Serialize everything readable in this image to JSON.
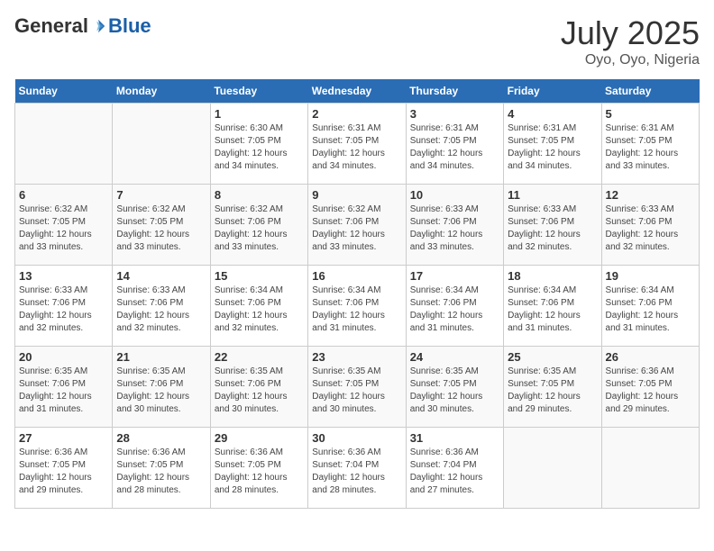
{
  "header": {
    "logo_general": "General",
    "logo_blue": "Blue",
    "month_title": "July 2025",
    "location": "Oyo, Oyo, Nigeria"
  },
  "weekdays": [
    "Sunday",
    "Monday",
    "Tuesday",
    "Wednesday",
    "Thursday",
    "Friday",
    "Saturday"
  ],
  "weeks": [
    [
      {
        "day": "",
        "sunrise": "",
        "sunset": "",
        "daylight": ""
      },
      {
        "day": "",
        "sunrise": "",
        "sunset": "",
        "daylight": ""
      },
      {
        "day": "1",
        "sunrise": "Sunrise: 6:30 AM",
        "sunset": "Sunset: 7:05 PM",
        "daylight": "Daylight: 12 hours and 34 minutes."
      },
      {
        "day": "2",
        "sunrise": "Sunrise: 6:31 AM",
        "sunset": "Sunset: 7:05 PM",
        "daylight": "Daylight: 12 hours and 34 minutes."
      },
      {
        "day": "3",
        "sunrise": "Sunrise: 6:31 AM",
        "sunset": "Sunset: 7:05 PM",
        "daylight": "Daylight: 12 hours and 34 minutes."
      },
      {
        "day": "4",
        "sunrise": "Sunrise: 6:31 AM",
        "sunset": "Sunset: 7:05 PM",
        "daylight": "Daylight: 12 hours and 34 minutes."
      },
      {
        "day": "5",
        "sunrise": "Sunrise: 6:31 AM",
        "sunset": "Sunset: 7:05 PM",
        "daylight": "Daylight: 12 hours and 33 minutes."
      }
    ],
    [
      {
        "day": "6",
        "sunrise": "Sunrise: 6:32 AM",
        "sunset": "Sunset: 7:05 PM",
        "daylight": "Daylight: 12 hours and 33 minutes."
      },
      {
        "day": "7",
        "sunrise": "Sunrise: 6:32 AM",
        "sunset": "Sunset: 7:05 PM",
        "daylight": "Daylight: 12 hours and 33 minutes."
      },
      {
        "day": "8",
        "sunrise": "Sunrise: 6:32 AM",
        "sunset": "Sunset: 7:06 PM",
        "daylight": "Daylight: 12 hours and 33 minutes."
      },
      {
        "day": "9",
        "sunrise": "Sunrise: 6:32 AM",
        "sunset": "Sunset: 7:06 PM",
        "daylight": "Daylight: 12 hours and 33 minutes."
      },
      {
        "day": "10",
        "sunrise": "Sunrise: 6:33 AM",
        "sunset": "Sunset: 7:06 PM",
        "daylight": "Daylight: 12 hours and 33 minutes."
      },
      {
        "day": "11",
        "sunrise": "Sunrise: 6:33 AM",
        "sunset": "Sunset: 7:06 PM",
        "daylight": "Daylight: 12 hours and 32 minutes."
      },
      {
        "day": "12",
        "sunrise": "Sunrise: 6:33 AM",
        "sunset": "Sunset: 7:06 PM",
        "daylight": "Daylight: 12 hours and 32 minutes."
      }
    ],
    [
      {
        "day": "13",
        "sunrise": "Sunrise: 6:33 AM",
        "sunset": "Sunset: 7:06 PM",
        "daylight": "Daylight: 12 hours and 32 minutes."
      },
      {
        "day": "14",
        "sunrise": "Sunrise: 6:33 AM",
        "sunset": "Sunset: 7:06 PM",
        "daylight": "Daylight: 12 hours and 32 minutes."
      },
      {
        "day": "15",
        "sunrise": "Sunrise: 6:34 AM",
        "sunset": "Sunset: 7:06 PM",
        "daylight": "Daylight: 12 hours and 32 minutes."
      },
      {
        "day": "16",
        "sunrise": "Sunrise: 6:34 AM",
        "sunset": "Sunset: 7:06 PM",
        "daylight": "Daylight: 12 hours and 31 minutes."
      },
      {
        "day": "17",
        "sunrise": "Sunrise: 6:34 AM",
        "sunset": "Sunset: 7:06 PM",
        "daylight": "Daylight: 12 hours and 31 minutes."
      },
      {
        "day": "18",
        "sunrise": "Sunrise: 6:34 AM",
        "sunset": "Sunset: 7:06 PM",
        "daylight": "Daylight: 12 hours and 31 minutes."
      },
      {
        "day": "19",
        "sunrise": "Sunrise: 6:34 AM",
        "sunset": "Sunset: 7:06 PM",
        "daylight": "Daylight: 12 hours and 31 minutes."
      }
    ],
    [
      {
        "day": "20",
        "sunrise": "Sunrise: 6:35 AM",
        "sunset": "Sunset: 7:06 PM",
        "daylight": "Daylight: 12 hours and 31 minutes."
      },
      {
        "day": "21",
        "sunrise": "Sunrise: 6:35 AM",
        "sunset": "Sunset: 7:06 PM",
        "daylight": "Daylight: 12 hours and 30 minutes."
      },
      {
        "day": "22",
        "sunrise": "Sunrise: 6:35 AM",
        "sunset": "Sunset: 7:06 PM",
        "daylight": "Daylight: 12 hours and 30 minutes."
      },
      {
        "day": "23",
        "sunrise": "Sunrise: 6:35 AM",
        "sunset": "Sunset: 7:05 PM",
        "daylight": "Daylight: 12 hours and 30 minutes."
      },
      {
        "day": "24",
        "sunrise": "Sunrise: 6:35 AM",
        "sunset": "Sunset: 7:05 PM",
        "daylight": "Daylight: 12 hours and 30 minutes."
      },
      {
        "day": "25",
        "sunrise": "Sunrise: 6:35 AM",
        "sunset": "Sunset: 7:05 PM",
        "daylight": "Daylight: 12 hours and 29 minutes."
      },
      {
        "day": "26",
        "sunrise": "Sunrise: 6:36 AM",
        "sunset": "Sunset: 7:05 PM",
        "daylight": "Daylight: 12 hours and 29 minutes."
      }
    ],
    [
      {
        "day": "27",
        "sunrise": "Sunrise: 6:36 AM",
        "sunset": "Sunset: 7:05 PM",
        "daylight": "Daylight: 12 hours and 29 minutes."
      },
      {
        "day": "28",
        "sunrise": "Sunrise: 6:36 AM",
        "sunset": "Sunset: 7:05 PM",
        "daylight": "Daylight: 12 hours and 28 minutes."
      },
      {
        "day": "29",
        "sunrise": "Sunrise: 6:36 AM",
        "sunset": "Sunset: 7:05 PM",
        "daylight": "Daylight: 12 hours and 28 minutes."
      },
      {
        "day": "30",
        "sunrise": "Sunrise: 6:36 AM",
        "sunset": "Sunset: 7:04 PM",
        "daylight": "Daylight: 12 hours and 28 minutes."
      },
      {
        "day": "31",
        "sunrise": "Sunrise: 6:36 AM",
        "sunset": "Sunset: 7:04 PM",
        "daylight": "Daylight: 12 hours and 27 minutes."
      },
      {
        "day": "",
        "sunrise": "",
        "sunset": "",
        "daylight": ""
      },
      {
        "day": "",
        "sunrise": "",
        "sunset": "",
        "daylight": ""
      }
    ]
  ]
}
